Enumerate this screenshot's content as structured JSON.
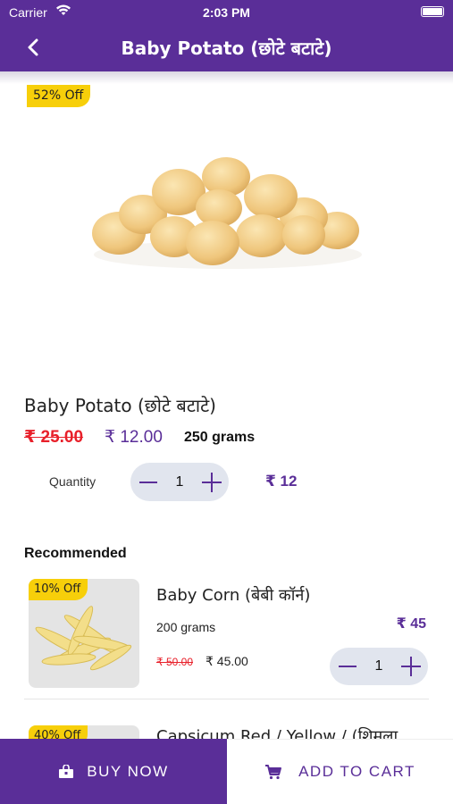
{
  "status_bar": {
    "carrier": "Carrier",
    "time": "2:03 PM"
  },
  "header": {
    "title": "Baby Potato (छोटे बटाटे)",
    "back_icon": "chevron-left-icon"
  },
  "product": {
    "discount": "52% Off",
    "name": "Baby Potato (छोटे बटाटे)",
    "old_price": "₹ 25.00",
    "new_price": "₹ 12.00",
    "weight": "250 grams",
    "quantity_label": "Quantity",
    "quantity": "1",
    "total": "₹ 12",
    "image": "potato-image"
  },
  "recommended": {
    "heading": "Recommended",
    "items": [
      {
        "discount": "10% Off",
        "name": "Baby Corn (बेबी कॉर्न)",
        "weight": "200 grams",
        "price": "₹ 45",
        "old_price": "₹ 50.00",
        "new_price": "₹ 45.00",
        "quantity": "1",
        "image": "baby-corn-image"
      },
      {
        "discount": "40% Off",
        "name": "Capsicum Red / Yellow / (शिमला"
      }
    ]
  },
  "bottom_bar": {
    "buy_now": "BUY NOW",
    "add_to_cart": "ADD TO CART",
    "buy_icon": "shopping-bag-icon",
    "cart_icon": "cart-icon"
  },
  "colors": {
    "brand": "#5a2e98",
    "badge": "#f7cf0a",
    "strike": "#e8202a"
  }
}
